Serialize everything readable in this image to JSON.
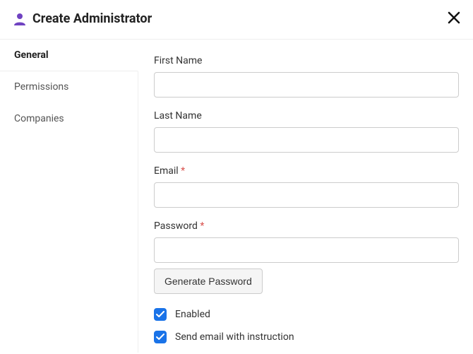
{
  "header": {
    "title": "Create Administrator"
  },
  "tabs": {
    "general": "General",
    "permissions": "Permissions",
    "companies": "Companies"
  },
  "form": {
    "first_name_label": "First Name",
    "first_name_value": "",
    "last_name_label": "Last Name",
    "last_name_value": "",
    "email_label": "Email",
    "email_value": "",
    "password_label": "Password",
    "password_value": "",
    "generate_password_label": "Generate Password",
    "enabled_label": "Enabled",
    "send_email_label": "Send email with instruction",
    "required_mark": "*"
  }
}
